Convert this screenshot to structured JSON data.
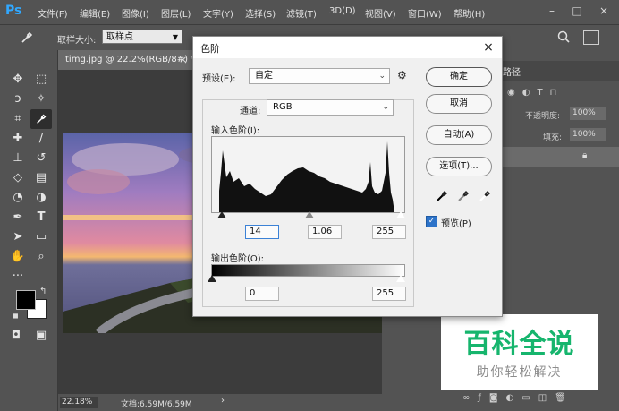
{
  "app": {
    "logo": "Ps",
    "menus": [
      "文件(F)",
      "编辑(E)",
      "图像(I)",
      "图层(L)",
      "文字(Y)",
      "选择(S)",
      "滤镜(T)",
      "3D(D)",
      "视图(V)",
      "窗口(W)",
      "帮助(H)"
    ]
  },
  "options_bar": {
    "sample_size_label": "取样大小:",
    "sample_size_value": "取样点"
  },
  "document": {
    "tab_title": "timg.jpg @ 22.2%(RGB/8#) *",
    "tab_close": "×",
    "zoom": "22.18%",
    "doc_size": "文档:6.59M/6.59M"
  },
  "right_panel": {
    "tab_paths": "路径",
    "opacity_label": "不透明度:",
    "opacity_value": "100%",
    "fill_label": "填充:",
    "fill_value": "100%"
  },
  "dialog": {
    "title": "色阶",
    "close": "×",
    "preset_label": "预设(E):",
    "preset_value": "自定",
    "channel_label": "通道:",
    "channel_value": "RGB",
    "input_levels_label": "输入色阶(I):",
    "input_black": "14",
    "input_gamma": "1.06",
    "input_white": "255",
    "output_levels_label": "输出色阶(O):",
    "output_black": "0",
    "output_white": "255",
    "buttons": {
      "ok": "确定",
      "cancel": "取消",
      "auto": "自动(A)",
      "options": "选项(T)..."
    },
    "preview_label": "预览(P)",
    "preview_checked": true
  },
  "watermark": {
    "title": "百科全说",
    "subtitle": "助你轻松解决"
  },
  "colors": {
    "accent_blue": "#31a8ff",
    "watermark_green": "#16b56d"
  },
  "icons": {
    "eyedropper_tool": "eyedropper-icon",
    "gear": "gear-icon",
    "search": "search-icon"
  }
}
